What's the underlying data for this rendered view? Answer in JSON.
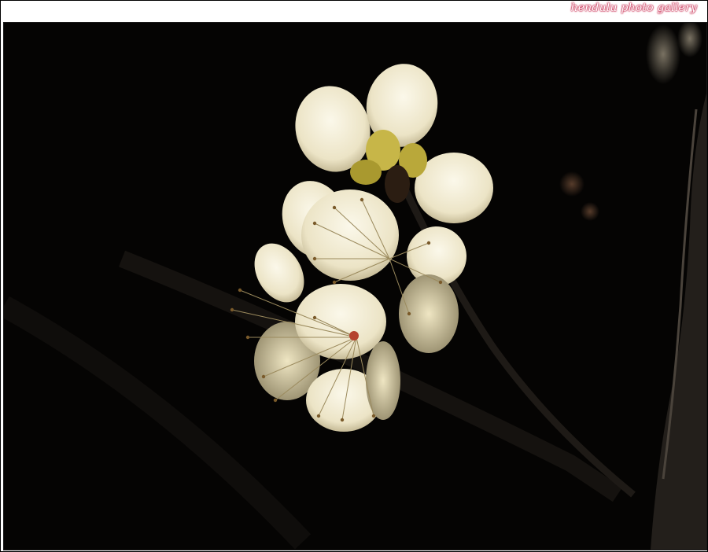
{
  "watermark": {
    "text": "hendulu photo gallery",
    "color": "#c0103a"
  },
  "photo": {
    "subject": "plum-blossom-icon",
    "background": "#050403",
    "petal_color": "#f1ecd7",
    "stamen_color": "#7a5a2a",
    "branch_color": "#2e2a25"
  }
}
